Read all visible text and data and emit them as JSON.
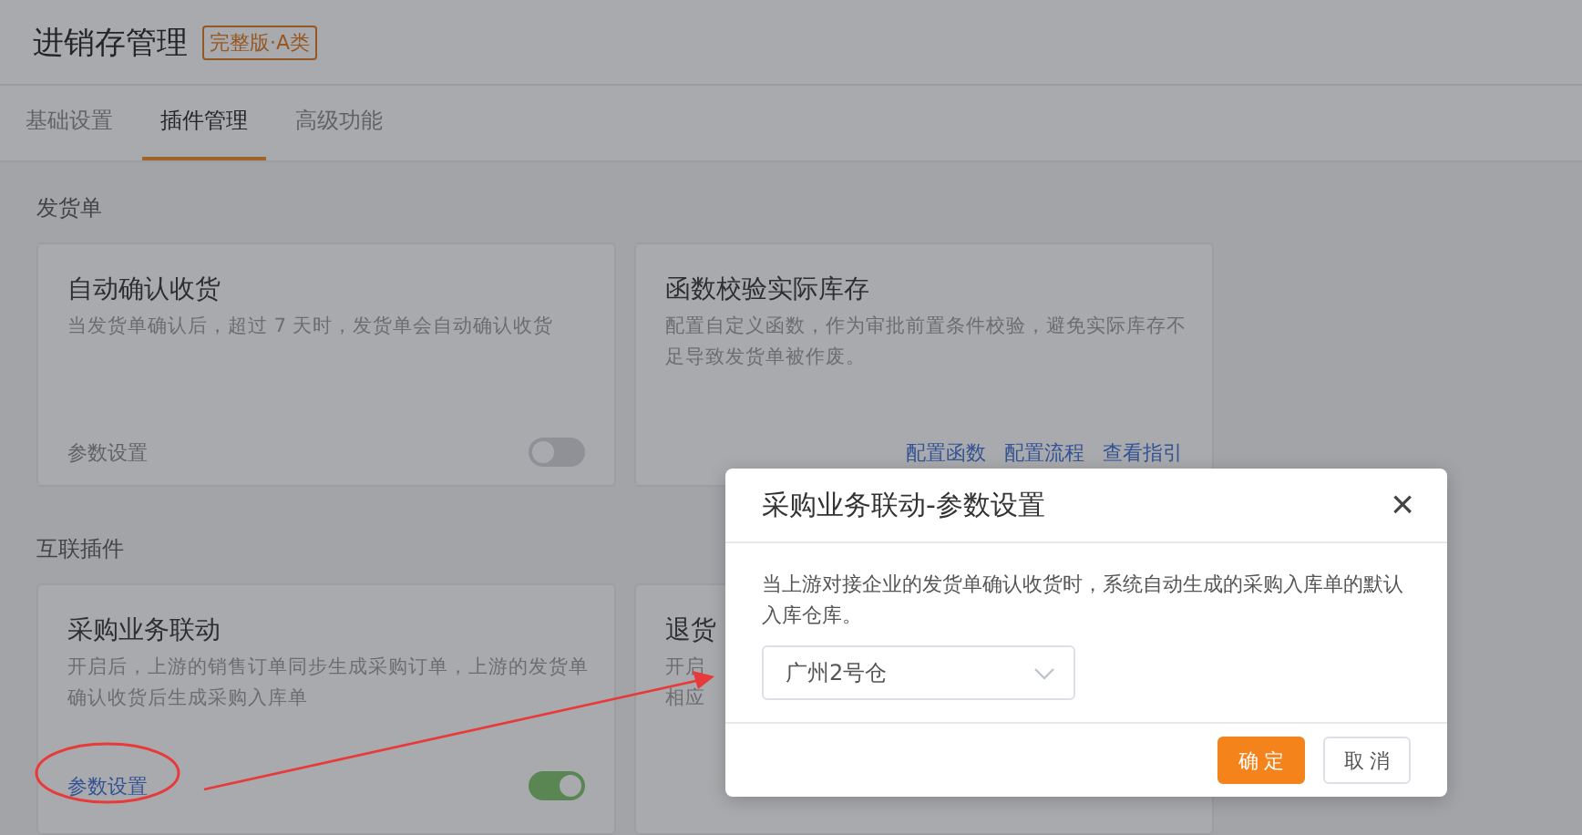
{
  "header": {
    "title": "进销存管理",
    "badge": "完整版·A类"
  },
  "tabs": [
    {
      "label": "基础设置",
      "selected": false
    },
    {
      "label": "插件管理",
      "selected": true
    },
    {
      "label": "高级功能",
      "selected": false
    }
  ],
  "sections": [
    {
      "title": "发货单",
      "cards": [
        {
          "title": "自动确认收货",
          "description": [
            "当发货单确认后，超过 7 天时，发货单会自动确认收货"
          ],
          "footer": {
            "kind": "toggle",
            "link": "参数设置",
            "on": false
          }
        },
        {
          "title": "函数校验实际库存",
          "description": [
            "配置自定义函数，作为审批前置条件校验，避免实际库存不",
            "足导致发货单被作废。"
          ],
          "footer": {
            "kind": "links",
            "links": [
              "配置函数",
              "配置流程",
              "查看指引"
            ]
          }
        }
      ]
    },
    {
      "title": "互联插件",
      "cards": [
        {
          "title": "采购业务联动",
          "description": [
            "开启后，上游的销售订单同步生成采购订单，上游的发货单",
            "确认收货后生成采购入库单"
          ],
          "footer": {
            "kind": "toggle",
            "link": "参数设置",
            "on": true
          }
        },
        {
          "title": "退货",
          "description": [
            "开启",
            "相应"
          ]
        }
      ]
    }
  ],
  "dialog": {
    "title": "采购业务联动-参数设置",
    "close": "×",
    "text": "当上游对接企业的发货单确认收货时，系统自动生成的采购入库单的默认入库仓库。",
    "select": {
      "value": "广州2号仓"
    },
    "buttons": [
      {
        "label": "确 定",
        "kind": "primary"
      },
      {
        "label": "取 消",
        "kind": "default"
      }
    ]
  }
}
